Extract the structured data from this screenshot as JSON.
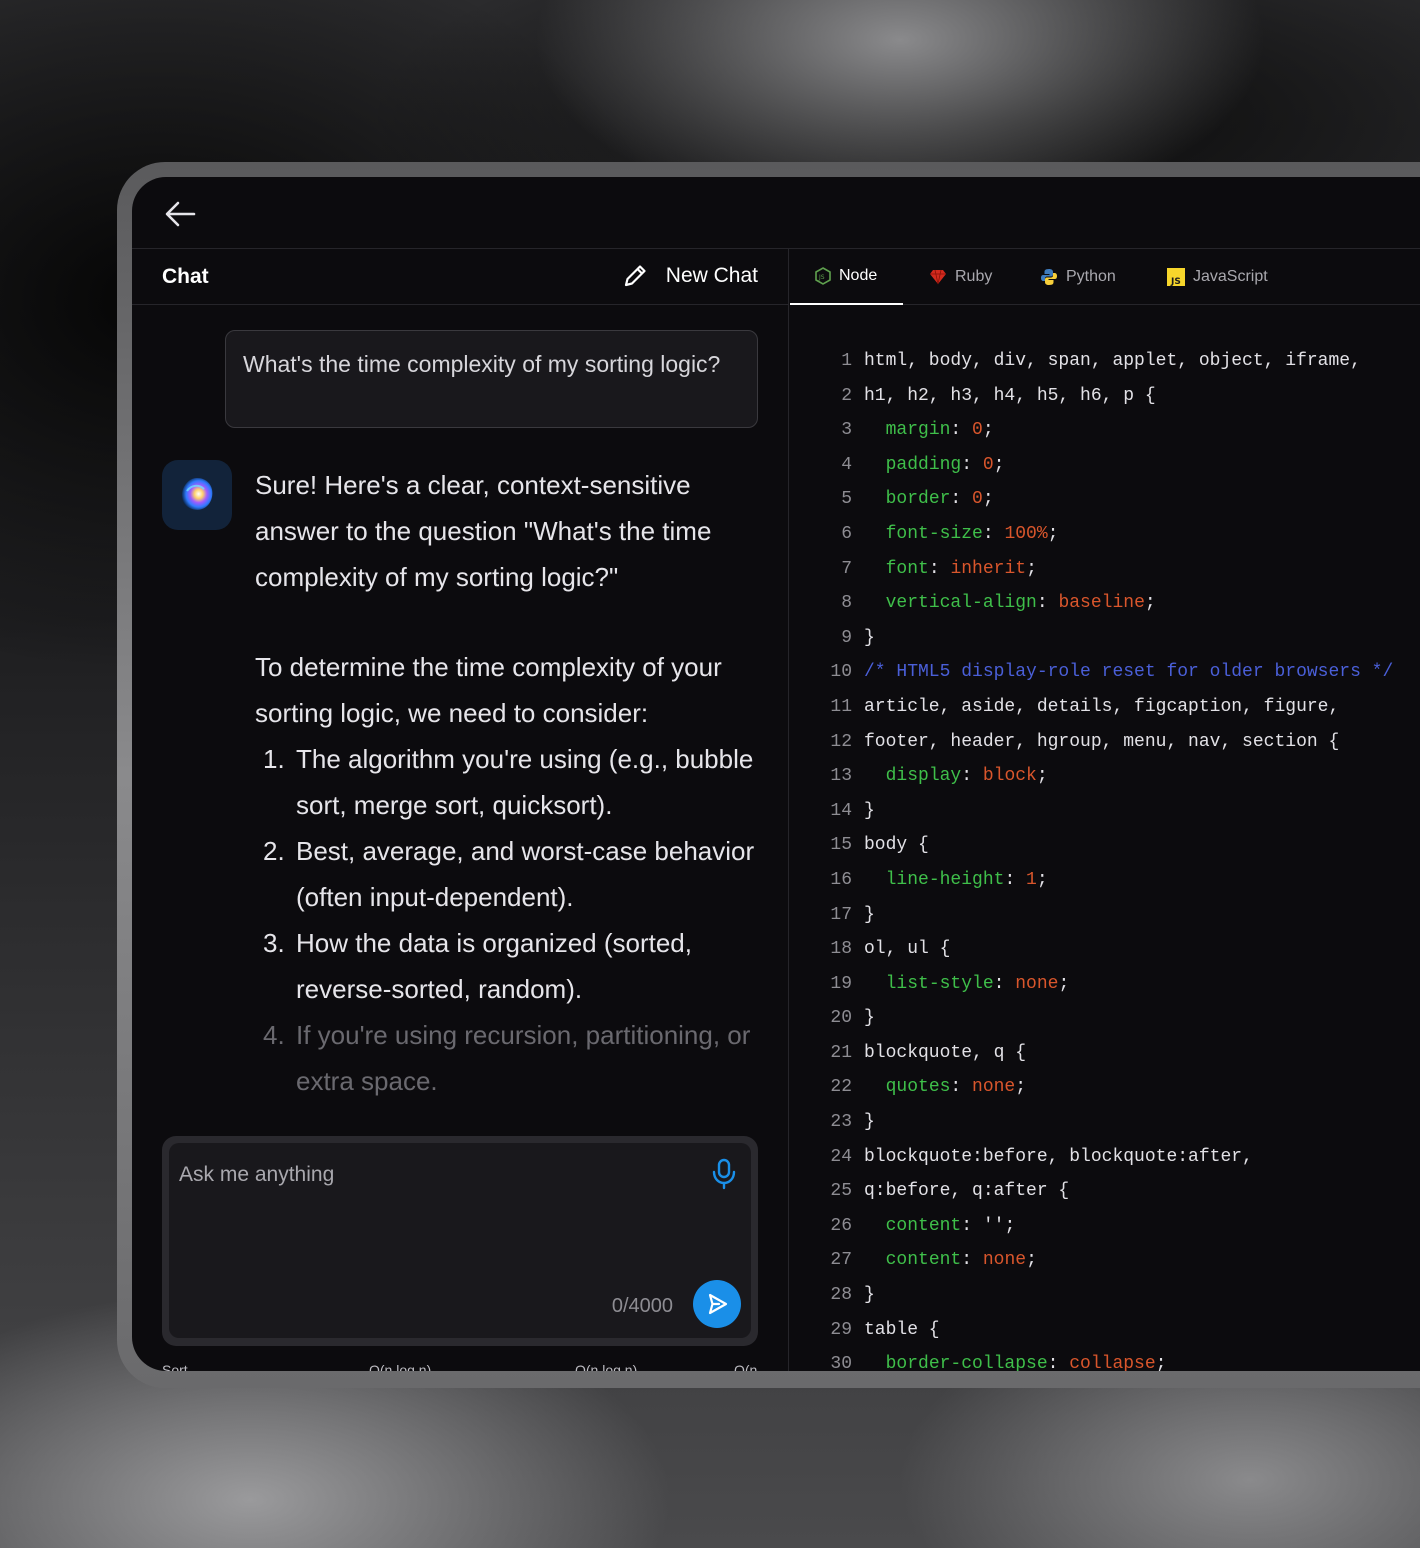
{
  "chat": {
    "title": "Chat",
    "new_chat_label": "New Chat",
    "user_message": "What's the time complexity of my sorting logic?",
    "answer_intro": "Sure! Here's a clear, context-sensitive answer to the question \"What's the time complexity of my sorting logic?\"",
    "answer_lead": "To determine the time complexity of your sorting logic, we need to consider:",
    "answer_points": [
      {
        "num": "1.",
        "text": "The algorithm you're using (e.g., bubble sort, merge sort, quicksort)."
      },
      {
        "num": "2.",
        "text": "Best, average, and worst-case behavior (often input-dependent)."
      },
      {
        "num": "3.",
        "text": "How the data is organized (sorted, reverse-sorted, random)."
      },
      {
        "num": "4.",
        "text": "If you're using recursion, partitioning, or extra space."
      }
    ],
    "input_placeholder": "Ask me anything",
    "char_count": "0/4000",
    "table_peek": [
      "Sort",
      "O(n log n)",
      "O(n log n)",
      "O(n"
    ]
  },
  "code": {
    "tabs": [
      {
        "label": "Node",
        "icon": "nodejs-icon",
        "active": true
      },
      {
        "label": "Ruby",
        "icon": "ruby-icon",
        "active": false
      },
      {
        "label": "Python",
        "icon": "python-icon",
        "active": false
      },
      {
        "label": "JavaScript",
        "icon": "javascript-icon",
        "active": false
      }
    ],
    "lines": [
      {
        "n": "1",
        "parts": [
          {
            "t": "sel",
            "v": "html, body, div, span, applet, object, iframe,"
          }
        ]
      },
      {
        "n": "2",
        "parts": [
          {
            "t": "sel",
            "v": "h1, h2, h3, h4, h5, h6, p {"
          }
        ]
      },
      {
        "n": "3",
        "parts": [
          {
            "t": "sel",
            "v": "  "
          },
          {
            "t": "prop",
            "v": "margin"
          },
          {
            "t": "sel",
            "v": ": "
          },
          {
            "t": "val",
            "v": "0"
          },
          {
            "t": "sel",
            "v": ";"
          }
        ]
      },
      {
        "n": "4",
        "parts": [
          {
            "t": "sel",
            "v": "  "
          },
          {
            "t": "prop",
            "v": "padding"
          },
          {
            "t": "sel",
            "v": ": "
          },
          {
            "t": "val",
            "v": "0"
          },
          {
            "t": "sel",
            "v": ";"
          }
        ]
      },
      {
        "n": "5",
        "parts": [
          {
            "t": "sel",
            "v": "  "
          },
          {
            "t": "prop",
            "v": "border"
          },
          {
            "t": "sel",
            "v": ": "
          },
          {
            "t": "val",
            "v": "0"
          },
          {
            "t": "sel",
            "v": ";"
          }
        ]
      },
      {
        "n": "6",
        "parts": [
          {
            "t": "sel",
            "v": "  "
          },
          {
            "t": "prop",
            "v": "font-size"
          },
          {
            "t": "sel",
            "v": ": "
          },
          {
            "t": "val",
            "v": "100%"
          },
          {
            "t": "sel",
            "v": ";"
          }
        ]
      },
      {
        "n": "7",
        "parts": [
          {
            "t": "sel",
            "v": "  "
          },
          {
            "t": "prop",
            "v": "font"
          },
          {
            "t": "sel",
            "v": ": "
          },
          {
            "t": "val",
            "v": "inherit"
          },
          {
            "t": "sel",
            "v": ";"
          }
        ]
      },
      {
        "n": "8",
        "parts": [
          {
            "t": "sel",
            "v": "  "
          },
          {
            "t": "prop",
            "v": "vertical-align"
          },
          {
            "t": "sel",
            "v": ": "
          },
          {
            "t": "val",
            "v": "baseline"
          },
          {
            "t": "sel",
            "v": ";"
          }
        ]
      },
      {
        "n": "9",
        "parts": [
          {
            "t": "sel",
            "v": "}"
          }
        ]
      },
      {
        "n": "10",
        "parts": [
          {
            "t": "com",
            "v": "/* HTML5 display-role reset for older browsers */"
          }
        ]
      },
      {
        "n": "11",
        "parts": [
          {
            "t": "sel",
            "v": "article, aside, details, figcaption, figure,"
          }
        ]
      },
      {
        "n": "12",
        "parts": [
          {
            "t": "sel",
            "v": "footer, header, hgroup, menu, nav, section {"
          }
        ]
      },
      {
        "n": "13",
        "parts": [
          {
            "t": "sel",
            "v": "  "
          },
          {
            "t": "prop",
            "v": "display"
          },
          {
            "t": "sel",
            "v": ": "
          },
          {
            "t": "val",
            "v": "block"
          },
          {
            "t": "sel",
            "v": ";"
          }
        ]
      },
      {
        "n": "14",
        "parts": [
          {
            "t": "sel",
            "v": "}"
          }
        ]
      },
      {
        "n": "15",
        "parts": [
          {
            "t": "sel",
            "v": "body {"
          }
        ]
      },
      {
        "n": "16",
        "parts": [
          {
            "t": "sel",
            "v": "  "
          },
          {
            "t": "prop",
            "v": "line-height"
          },
          {
            "t": "sel",
            "v": ": "
          },
          {
            "t": "val",
            "v": "1"
          },
          {
            "t": "sel",
            "v": ";"
          }
        ]
      },
      {
        "n": "17",
        "parts": [
          {
            "t": "sel",
            "v": "}"
          }
        ]
      },
      {
        "n": "18",
        "parts": [
          {
            "t": "sel",
            "v": "ol, ul {"
          }
        ]
      },
      {
        "n": "19",
        "parts": [
          {
            "t": "sel",
            "v": "  "
          },
          {
            "t": "prop",
            "v": "list-style"
          },
          {
            "t": "sel",
            "v": ": "
          },
          {
            "t": "val",
            "v": "none"
          },
          {
            "t": "sel",
            "v": ";"
          }
        ]
      },
      {
        "n": "20",
        "parts": [
          {
            "t": "sel",
            "v": "}"
          }
        ]
      },
      {
        "n": "21",
        "parts": [
          {
            "t": "sel",
            "v": "blockquote, q {"
          }
        ]
      },
      {
        "n": "22",
        "parts": [
          {
            "t": "sel",
            "v": "  "
          },
          {
            "t": "prop",
            "v": "quotes"
          },
          {
            "t": "sel",
            "v": ": "
          },
          {
            "t": "val",
            "v": "none"
          },
          {
            "t": "sel",
            "v": ";"
          }
        ]
      },
      {
        "n": "23",
        "parts": [
          {
            "t": "sel",
            "v": "}"
          }
        ]
      },
      {
        "n": "24",
        "parts": [
          {
            "t": "sel",
            "v": "blockquote:before, blockquote:after,"
          }
        ]
      },
      {
        "n": "25",
        "parts": [
          {
            "t": "sel",
            "v": "q:before, q:after {"
          }
        ]
      },
      {
        "n": "26",
        "parts": [
          {
            "t": "sel",
            "v": "  "
          },
          {
            "t": "prop",
            "v": "content"
          },
          {
            "t": "sel",
            "v": ": '';"
          }
        ]
      },
      {
        "n": "27",
        "parts": [
          {
            "t": "sel",
            "v": "  "
          },
          {
            "t": "prop",
            "v": "content"
          },
          {
            "t": "sel",
            "v": ": "
          },
          {
            "t": "val",
            "v": "none"
          },
          {
            "t": "sel",
            "v": ";"
          }
        ]
      },
      {
        "n": "28",
        "parts": [
          {
            "t": "sel",
            "v": "}"
          }
        ]
      },
      {
        "n": "29",
        "parts": [
          {
            "t": "sel",
            "v": "table {"
          }
        ]
      },
      {
        "n": "30",
        "parts": [
          {
            "t": "sel",
            "v": "  "
          },
          {
            "t": "prop",
            "v": "border-collapse"
          },
          {
            "t": "sel",
            "v": ": "
          },
          {
            "t": "val",
            "v": "collapse"
          },
          {
            "t": "sel",
            "v": ";"
          }
        ]
      }
    ]
  },
  "colors": {
    "accent": "#1a8fe8",
    "property": "#3fbf4a",
    "value": "#d9562c",
    "comment": "#4a5fd8"
  }
}
